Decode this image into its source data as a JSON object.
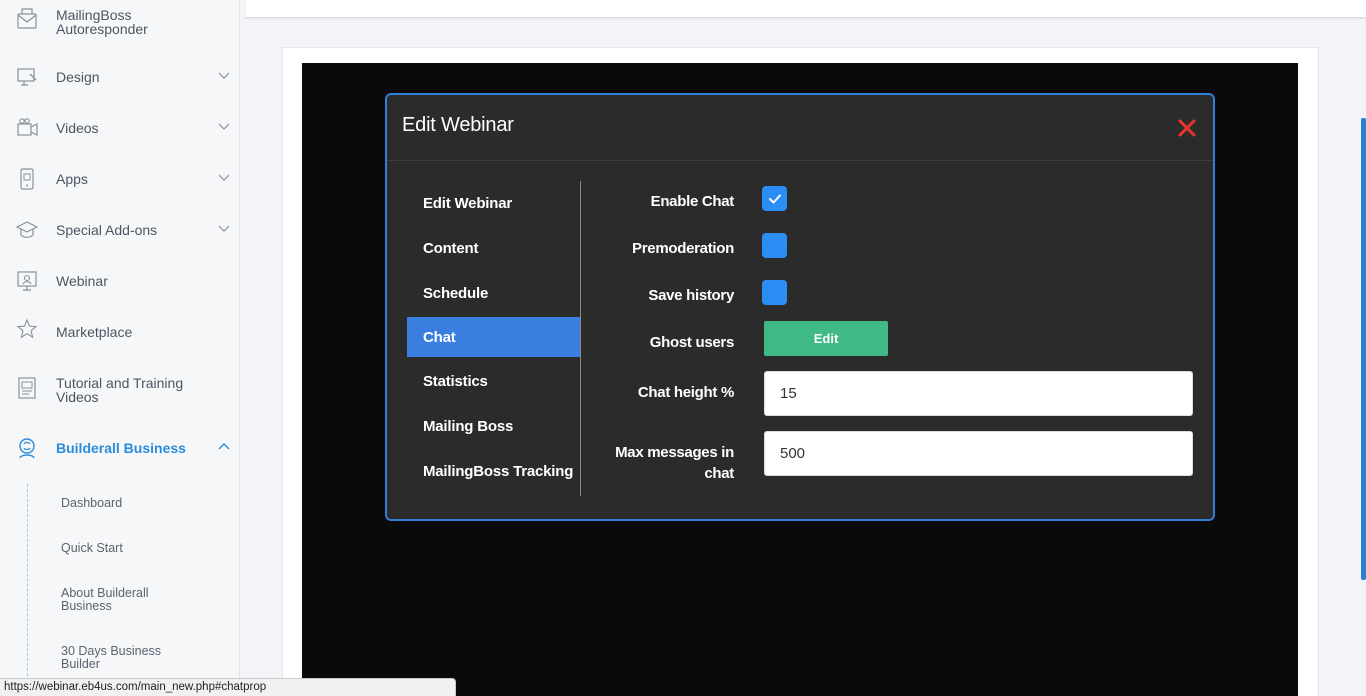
{
  "sidebar": {
    "items": [
      {
        "label": "MailingBoss Autoresponder",
        "icon": "mail-envelope-icon"
      },
      {
        "label": "Design",
        "icon": "design-monitor-icon"
      },
      {
        "label": "Videos",
        "icon": "video-camera-icon"
      },
      {
        "label": "Apps",
        "icon": "mobile-app-icon"
      },
      {
        "label": "Special Add-ons",
        "icon": "graduation-cap-icon"
      },
      {
        "label": "Webinar",
        "icon": "presentation-board-icon"
      },
      {
        "label": "Marketplace",
        "icon": "star-icon"
      },
      {
        "label": "Tutorial and Training Videos",
        "icon": "training-book-icon"
      },
      {
        "label": "Builderall Business",
        "icon": "business-brain-icon"
      }
    ],
    "sub_items": [
      {
        "label": "Dashboard"
      },
      {
        "label": "Quick Start"
      },
      {
        "label": "About Builderall Business"
      },
      {
        "label": "30 Days Business Builder"
      }
    ]
  },
  "modal": {
    "title": "Edit Webinar",
    "tabs": [
      {
        "label": "Edit Webinar"
      },
      {
        "label": "Content"
      },
      {
        "label": "Schedule"
      },
      {
        "label": "Chat"
      },
      {
        "label": "Statistics"
      },
      {
        "label": "Mailing Boss"
      },
      {
        "label": "MailingBoss Tracking"
      }
    ],
    "active_tab": "Chat",
    "fields": {
      "enable_chat": {
        "label": "Enable Chat",
        "checked": true
      },
      "premoderation": {
        "label": "Premoderation",
        "checked": false
      },
      "save_history": {
        "label": "Save history",
        "checked": false
      },
      "ghost_users": {
        "label": "Ghost users",
        "button": "Edit"
      },
      "chat_height": {
        "label": "Chat height %",
        "value": "15"
      },
      "max_messages": {
        "label": "Max messages in chat",
        "value": "500"
      }
    }
  },
  "status_bar": {
    "url": "https://webinar.eb4us.com/main_new.php#chatprop"
  },
  "colors": {
    "accent": "#2a8bdb",
    "active_tab": "#3a7ee0",
    "checkbox": "#2b8ef4",
    "edit_button": "#3fb985",
    "close": "#e8352b",
    "modal_bg": "#2b2b2b"
  }
}
